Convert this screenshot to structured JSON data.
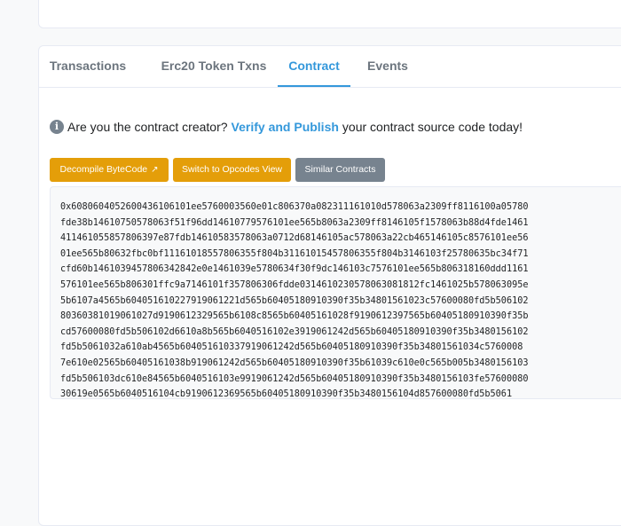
{
  "tabs": [
    {
      "label": "Transactions",
      "active": false
    },
    {
      "label": "Erc20 Token Txns",
      "active": false
    },
    {
      "label": "Contract",
      "active": true
    },
    {
      "label": "Events",
      "active": false
    }
  ],
  "notice": {
    "icon": "info-icon",
    "prefix": "Are you the contract creator?",
    "link": "Verify and Publish",
    "suffix": "your contract source code today!"
  },
  "buttons": {
    "decompile": "Decompile ByteCode",
    "opcodes": "Switch to Opcodes View",
    "similar": "Similar Contracts"
  },
  "bytecode": {
    "lines": [
      "0x608060405260043610610 1ee5760003560e01c806370a082311161010d578063a2309ff8116100a05780",
      "fde38b14610750578063f51f96dd14610779576101ee565b8063a2309ff8146105f1578063b88d4fde1461",
      "411461055857806397e87fdb14610583578063a0712d68146105ac578063a22cb465146105c8576101ee56",
      "01ee565b80632fbc0bf11161018557806355f804b3116101545780635 5f804b3146103f25780635bc34f71",
      "cfd60b14610394578063428 42e0e1461039e5780634f30f9dc146103c7576101ee565b806318160ddd1161",
      "576101ee565b806301ffc9a7146101f357806306fdde031461023057806308 1812fc1461025b578063095e",
      "5b6107a4565b604051610227919061221d565b60405180910390f35b34801561023c57600080fd5b506102",
      "80360381019061027d9190612329565b6108c8565b60405161028f9190612397565b60405180910390f35b",
      "cd57600080fd5b506102d6610a8b565b6040516102e3919061242d565b60405180910390f35b3480156102",
      "fd5b5061032a610ab4565b6040516103379190 61242d565b60405180910390f35b34801561034c5760008",
      "7e610e02565b60405161038b919061242d565b60405180910390f35b61039c610e0c565b005b348015610 3",
      "fd5b506103dc610e84565b6040516103e9919061242d565b60405180910390f35b3480156103fe57600080",
      "30619e0565b6040516104cb919061236 9565b60405180910390f35b3480156104d857600080fd5b5061"
    ]
  }
}
